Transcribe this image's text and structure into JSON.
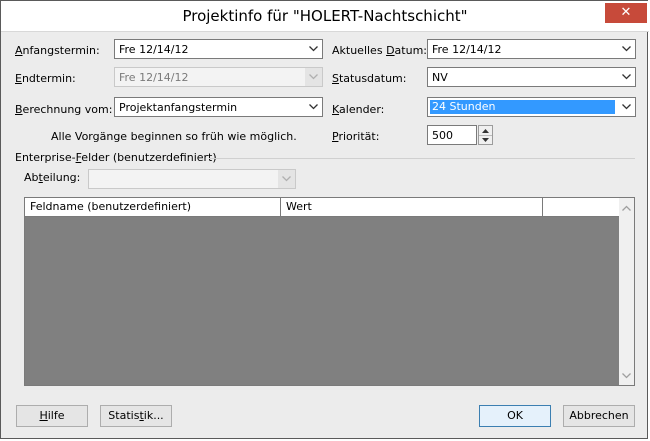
{
  "window": {
    "title": "Projektinfo für \"HOLERT-Nachtschicht\"",
    "close_glyph": "✕"
  },
  "form": {
    "start_label": "Anfangstermin:",
    "start_value": "Fre 12/14/12",
    "end_label": "Endtermin:",
    "end_value": "Fre 12/14/12",
    "schedule_from_label": "Berechnung vom:",
    "schedule_from_value": "Projektanfangstermin",
    "schedule_note": "Alle Vorgänge beginnen so früh wie möglich.",
    "current_date_label": "Aktuelles Datum:",
    "current_date_value": "Fre 12/14/12",
    "status_date_label": "Statusdatum:",
    "status_date_value": "NV",
    "calendar_label": "Kalender:",
    "calendar_value": "24 Stunden",
    "priority_label": "Priorität:",
    "priority_value": "500"
  },
  "enterprise": {
    "group_label": "Enterprise-Felder (benutzerdefiniert)",
    "department_label": "Abteilung:",
    "department_value": "",
    "columns": [
      "Feldname (benutzerdefiniert)",
      "Wert"
    ]
  },
  "buttons": {
    "help": "Hilfe",
    "statistics": "Statistik...",
    "ok": "OK",
    "cancel": "Abbrechen"
  },
  "colors": {
    "selection": "#3399ff",
    "grid_body": "#808080",
    "close_button": "#c74a3a",
    "dialog_bg": "#ececec"
  }
}
